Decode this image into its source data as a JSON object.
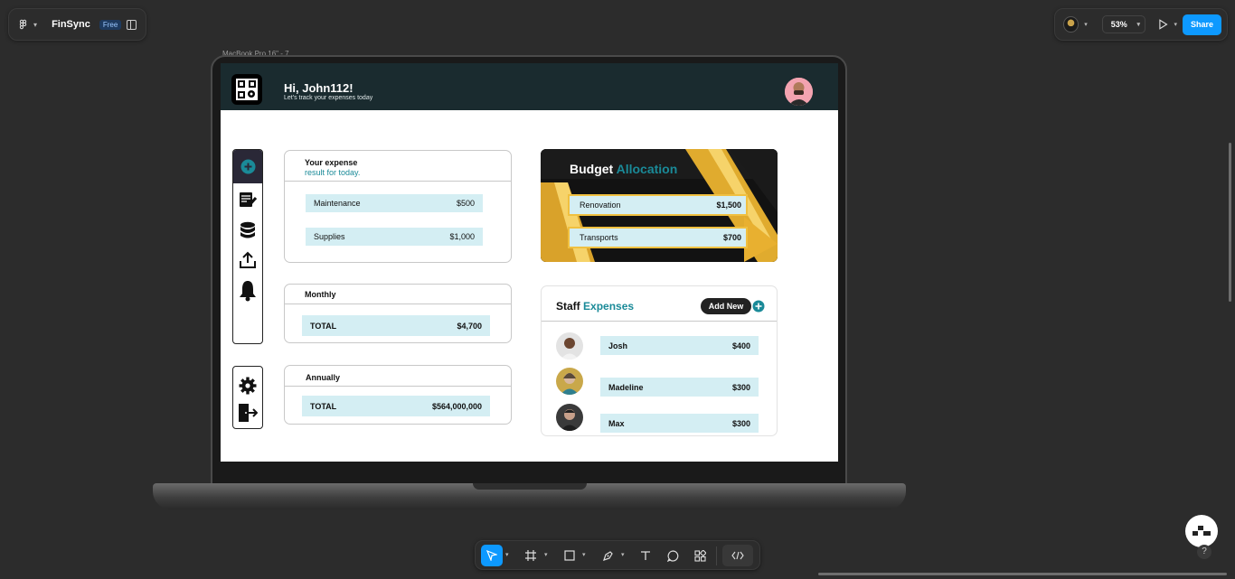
{
  "editor": {
    "file_name": "FinSync",
    "plan_badge": "Free",
    "zoom": "53%",
    "share_label": "Share",
    "frame_label": "MacBook Pro 16\" - 7"
  },
  "app": {
    "greeting": "Hi, John112!",
    "subtitle": "Let's track your expenses today",
    "today_card": {
      "title_line1": "Your expense",
      "title_line2": "result for today.",
      "items": [
        {
          "label": "Maintenance",
          "value": "$500"
        },
        {
          "label": "Supplies",
          "value": "$1,000"
        }
      ]
    },
    "monthly": {
      "title": "Monthly",
      "label": "TOTAL",
      "value": "$4,700"
    },
    "annually": {
      "title": "Annually",
      "label": "TOTAL",
      "value": "$564,000,000"
    },
    "budget": {
      "title_part1": "Budget",
      "title_part2": "Allocation",
      "items": [
        {
          "label": "Renovation",
          "value": "$1,500"
        },
        {
          "label": "Transports",
          "value": "$700"
        }
      ]
    },
    "staff": {
      "title_part1": "Staff",
      "title_part2": "Expenses",
      "add_label": "Add New",
      "rows": [
        {
          "name": "Josh",
          "value": "$400"
        },
        {
          "name": "Madeline",
          "value": "$300"
        },
        {
          "name": "Max",
          "value": "$300"
        }
      ]
    }
  },
  "colors": {
    "accent_blue": "#0d99ff",
    "teal": "#1a8a98",
    "header_dark": "#1a2b2f",
    "pill_bg": "#d4eef3",
    "gold": "#f0c040"
  },
  "icons": {
    "sidebar_top": [
      "add-circle-icon",
      "notes-icon",
      "database-icon",
      "upload-icon",
      "bell-icon"
    ],
    "sidebar_bottom": [
      "gear-icon",
      "logout-icon"
    ],
    "toolbar": [
      "move-icon",
      "frame-icon",
      "rectangle-icon",
      "pen-icon",
      "text-icon",
      "comment-icon",
      "components-icon",
      "code-icon"
    ]
  }
}
